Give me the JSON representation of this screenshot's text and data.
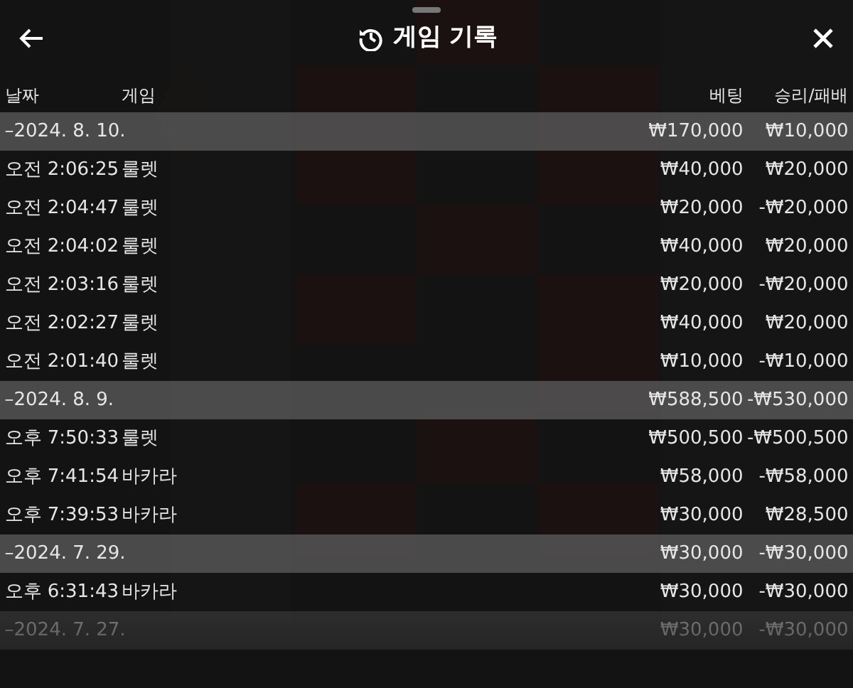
{
  "header": {
    "title": "게임 기록"
  },
  "columns": {
    "date": "날짜",
    "game": "게임",
    "bet": "베팅",
    "result": "승리/패배"
  },
  "groups": [
    {
      "date": "–2024. 8. 10.",
      "bet": "₩170,000",
      "result": "₩10,000",
      "faded": false,
      "rows": [
        {
          "time": "오전 2:06:25",
          "game": "룰렛",
          "bet": "₩40,000",
          "result": "₩20,000"
        },
        {
          "time": "오전 2:04:47",
          "game": "룰렛",
          "bet": "₩20,000",
          "result": "-₩20,000"
        },
        {
          "time": "오전 2:04:02",
          "game": "룰렛",
          "bet": "₩40,000",
          "result": "₩20,000"
        },
        {
          "time": "오전 2:03:16",
          "game": "룰렛",
          "bet": "₩20,000",
          "result": "-₩20,000"
        },
        {
          "time": "오전 2:02:27",
          "game": "룰렛",
          "bet": "₩40,000",
          "result": "₩20,000"
        },
        {
          "time": "오전 2:01:40",
          "game": "룰렛",
          "bet": "₩10,000",
          "result": "-₩10,000"
        }
      ]
    },
    {
      "date": "–2024. 8. 9.",
      "bet": "₩588,500",
      "result": "-₩530,000",
      "faded": false,
      "rows": [
        {
          "time": "오후 7:50:33",
          "game": "룰렛",
          "bet": "₩500,500",
          "result": "-₩500,500"
        },
        {
          "time": "오후 7:41:54",
          "game": "바카라",
          "bet": "₩58,000",
          "result": "-₩58,000"
        },
        {
          "time": "오후 7:39:53",
          "game": "바카라",
          "bet": "₩30,000",
          "result": "₩28,500"
        }
      ]
    },
    {
      "date": "–2024. 7. 29.",
      "bet": "₩30,000",
      "result": "-₩30,000",
      "faded": false,
      "rows": [
        {
          "time": "오후 6:31:43",
          "game": "바카라",
          "bet": "₩30,000",
          "result": "-₩30,000"
        }
      ]
    },
    {
      "date": "–2024. 7. 27.",
      "bet": "₩30,000",
      "result": "-₩30,000",
      "faded": true
    }
  ]
}
